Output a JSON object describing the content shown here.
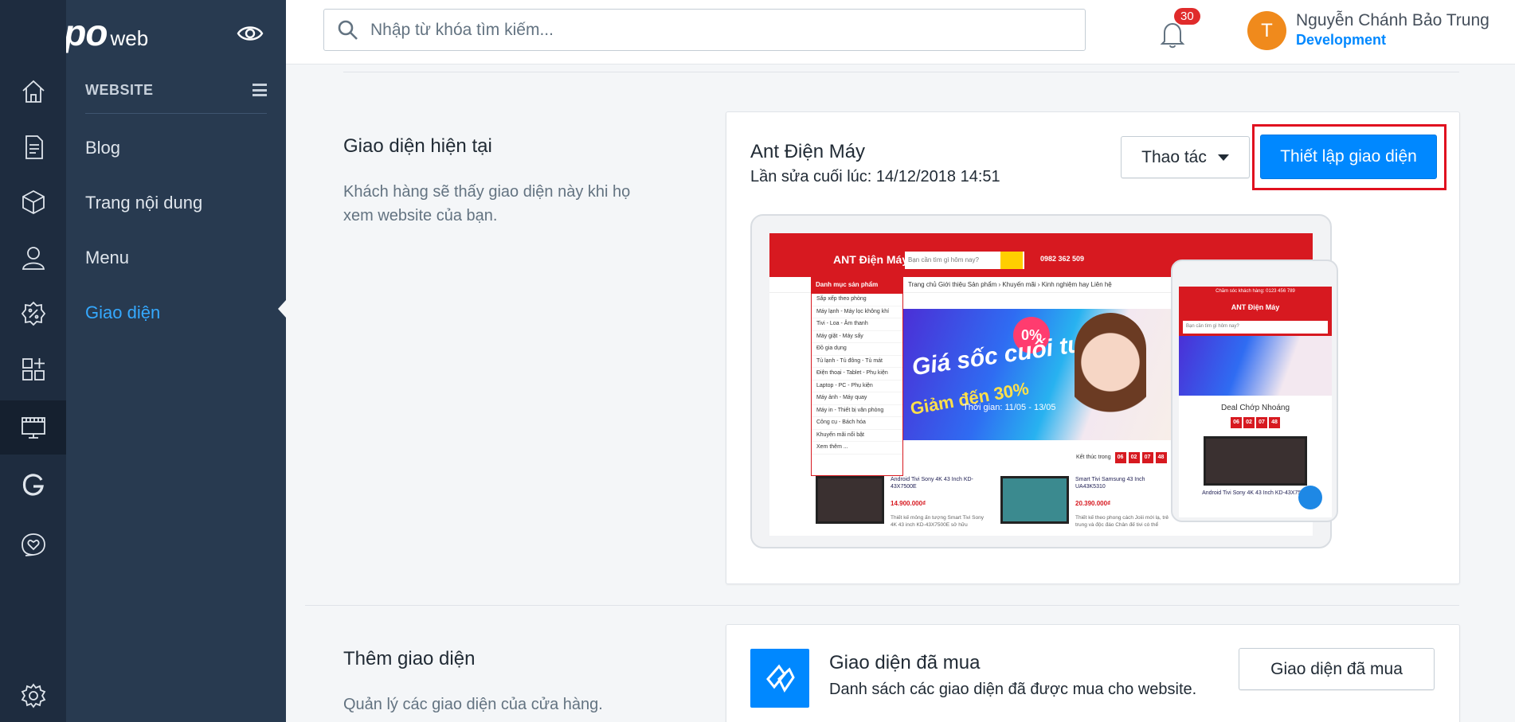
{
  "brand": {
    "logo_main": "Sapo",
    "logo_sub": "web"
  },
  "search": {
    "placeholder": "Nhập từ khóa tìm kiếm..."
  },
  "notifications": {
    "count": "30"
  },
  "user": {
    "initial": "T",
    "name": "Nguyễn Chánh Bảo Trung",
    "role": "Development"
  },
  "rail": {
    "items": [
      {
        "icon": "home-icon"
      },
      {
        "icon": "orders-icon"
      },
      {
        "icon": "products-icon"
      },
      {
        "icon": "customers-icon"
      },
      {
        "icon": "promotions-icon"
      },
      {
        "icon": "apps-icon"
      },
      {
        "icon": "website-icon",
        "active": true
      },
      {
        "icon": "google-icon"
      },
      {
        "icon": "support-icon"
      },
      {
        "icon": "settings-icon"
      }
    ]
  },
  "subnav": {
    "heading": "WEBSITE",
    "items": [
      {
        "label": "Blog"
      },
      {
        "label": "Trang nội dung"
      },
      {
        "label": "Menu"
      },
      {
        "label": "Giao diện",
        "active": true
      }
    ]
  },
  "current_theme": {
    "section_title": "Giao diện hiện tại",
    "section_desc": "Khách hàng sẽ thấy giao diện này khi họ xem website của bạn.",
    "theme_name": "Ant Điện Máy",
    "last_edit": "Lần sửa cuối lúc: 14/12/2018 14:51",
    "actions_label": "Thao tác",
    "setup_label": "Thiết lập giao diện"
  },
  "preview": {
    "logo": "ANT Điện Máy",
    "search_placeholder": "Bạn cần tìm gì hôm nay?",
    "hotline": "0982 362 509",
    "category_button": "Danh mục sản phẩm",
    "menu": "Trang chủ    Giới thiệu    Sản phẩm ›    Khuyến mãi ›    Kinh nghiệm hay    Liên hệ",
    "categories": [
      "Sắp xếp theo phòng",
      "Máy lạnh - Máy lọc không khí",
      "Tivi - Loa - Âm thanh",
      "Máy giặt - Máy sấy",
      "Đồ gia dụng",
      "Tủ lạnh - Tủ đông - Tủ mát",
      "Điện thoại - Tablet - Phụ kiện",
      "Laptop - PC - Phụ kiện",
      "Máy ảnh - Máy quay",
      "Máy in - Thiết bị văn phòng",
      "Công cụ - Bách hóa",
      "Khuyến mãi nổi bật",
      "Xem thêm ..."
    ],
    "banner_title": "Giá sốc cuối tuần",
    "banner_discount": "Giảm đến 30%",
    "banner_time": "Thời gian: 11/05 - 13/05",
    "banner_tag": "0%",
    "countdown_label": "Kết thúc trong",
    "countdown": [
      "06",
      "02",
      "07",
      "48"
    ],
    "products": [
      {
        "title": "Android Tivi Sony 4K 43 Inch KD-43X7500E",
        "price": "14.900.000₫",
        "desc": "Thiết kế mỏng ấn tượng Smart Tivi Sony 4K 43 inch KD-43X7500E sở hữu"
      },
      {
        "title": "Smart Tivi Samsung 43 Inch UA43K5310",
        "price": "20.390.000₫",
        "desc": "Thiết kế theo phong cách Joiii mới lạ, trẻ trung và độc đáo Chân đế tivi có thể"
      }
    ],
    "mobile_top": "Chăm sóc khách hàng: 0123 456 789",
    "mobile_deal": "Deal Chớp Nhoáng",
    "mobile_product": "Android Tivi Sony 4K 43 Inch KD-43X750..."
  },
  "add_theme": {
    "section_title": "Thêm giao diện",
    "section_desc": "Quản lý các giao diện của cửa hàng.",
    "bought_title": "Giao diện đã mua",
    "bought_desc": "Danh sách các giao diện đã được mua cho website.",
    "bought_button": "Giao diện đã mua"
  }
}
